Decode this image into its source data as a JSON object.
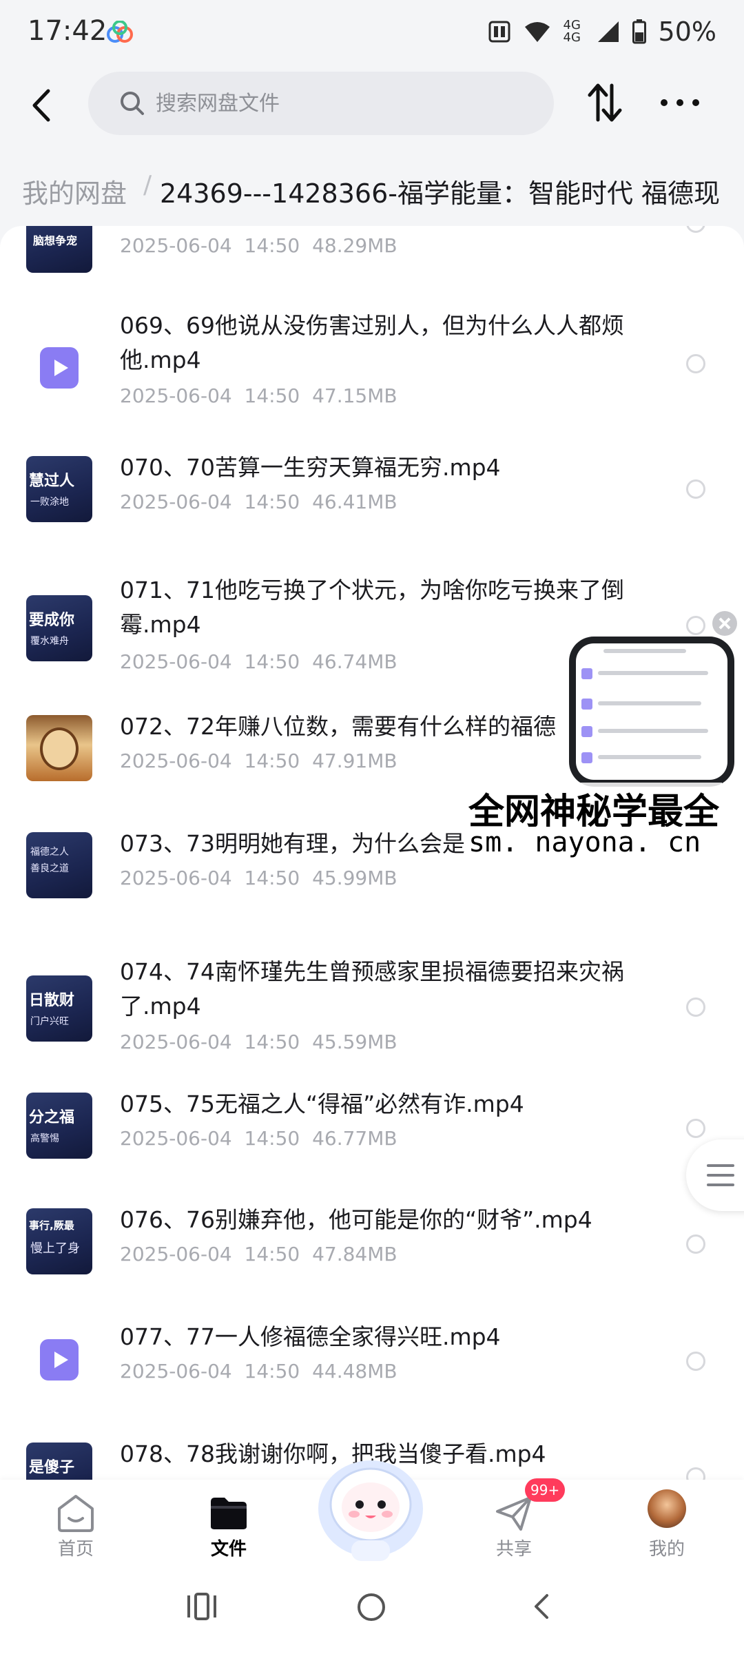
{
  "status_bar": {
    "time": "17:42",
    "network": "4G",
    "battery": "50%"
  },
  "header": {
    "search_placeholder": "搜索网盘文件"
  },
  "breadcrumb": {
    "root": "我的网盘",
    "separator": "/",
    "current": "24369---1428366-福学能量：智能时代 福德现"
  },
  "files": [
    {
      "title": "",
      "date": "2025-06-04",
      "time": "14:50",
      "size": "48.29MB",
      "thumb_text": "脑想争宠"
    },
    {
      "title": "069、69他说从没伤害过别人，但为什么人人都烦他.mp4",
      "date": "2025-06-04",
      "time": "14:50",
      "size": "47.15MB",
      "thumb_text": ""
    },
    {
      "title": "070、70苦算一生穷天算福无穷.mp4",
      "date": "2025-06-04",
      "time": "14:50",
      "size": "46.41MB",
      "thumb_text": "慧过人"
    },
    {
      "title": "071、71他吃亏换了个状元，为啥你吃亏换来了倒霉.mp4",
      "date": "2025-06-04",
      "time": "14:50",
      "size": "46.74MB",
      "thumb_text": "要成你"
    },
    {
      "title": "072、72年赚八位数，需要有什么样的福德",
      "date": "2025-06-04",
      "time": "14:50",
      "size": "47.91MB",
      "thumb_text": ""
    },
    {
      "title": "073、73明明她有理，为什么会是",
      "date": "2025-06-04",
      "time": "14:50",
      "size": "45.99MB",
      "thumb_text": ""
    },
    {
      "title": "074、74南怀瑾先生曾预感家里损福德要招来灾祸了.mp4",
      "date": "2025-06-04",
      "time": "14:50",
      "size": "45.59MB",
      "thumb_text": "日散财"
    },
    {
      "title": "075、75无福之人“得福”必然有诈.mp4",
      "date": "2025-06-04",
      "time": "14:50",
      "size": "46.77MB",
      "thumb_text": "分之福"
    },
    {
      "title": "076、76别嫌弃他，他可能是你的“财爷”.mp4",
      "date": "2025-06-04",
      "time": "14:50",
      "size": "47.84MB",
      "thumb_text": "事行,厥最"
    },
    {
      "title": "077、77一人修福德全家得兴旺.mp4",
      "date": "2025-06-04",
      "time": "14:50",
      "size": "44.48MB",
      "thumb_text": ""
    },
    {
      "title": "078、78我谢谢你啊，把我当傻子看.mp4",
      "date": "",
      "time": "",
      "size": "",
      "thumb_text": "是傻子"
    }
  ],
  "thumb_subtext": {
    "f2": "一败涂地",
    "f3": "覆水难舟",
    "f6": "门户兴旺",
    "f7": "高警惕",
    "f8": "慢上了身"
  },
  "watermark": {
    "title": "全网神秘学最全",
    "url": "sm. nayona. cn"
  },
  "bottom_nav": {
    "home": "首页",
    "files": "文件",
    "share": "共享",
    "mine": "我的",
    "share_badge": "99+"
  },
  "colors": {
    "accent_video": "#8a7cf3",
    "badge": "#ff3b5c"
  }
}
